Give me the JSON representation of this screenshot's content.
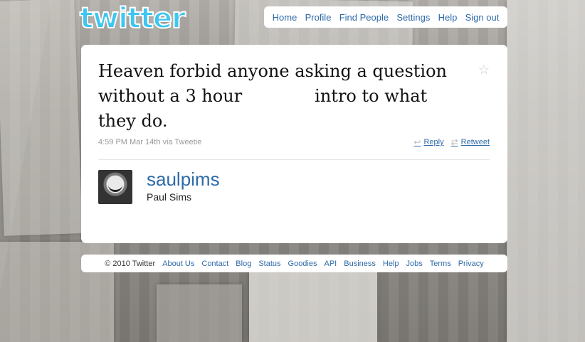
{
  "brand": {
    "logo_text": "twitter",
    "color": "#3fc6f0"
  },
  "nav": {
    "items": [
      "Home",
      "Profile",
      "Find People",
      "Settings",
      "Help",
      "Sign out"
    ]
  },
  "tweet": {
    "text_line1": "Heaven forbid anyone asking a question",
    "text_line2_a": "without a 3 hour",
    "text_line2_b": "intro to what",
    "text_line3": "they do.",
    "meta": "4:59 PM Mar 14th via Tweetie",
    "star_icon": "star-outline-icon",
    "reply_label": "Reply",
    "retweet_label": "Retweet"
  },
  "author": {
    "screen_name": "saulpims",
    "real_name": "Paul Sims"
  },
  "footer": {
    "copyright": "© 2010 Twitter",
    "links": [
      "About Us",
      "Contact",
      "Blog",
      "Status",
      "Goodies",
      "API",
      "Business",
      "Help",
      "Jobs",
      "Terms",
      "Privacy"
    ]
  },
  "colors": {
    "link": "#2e6aa8",
    "card": "#ffffff"
  }
}
